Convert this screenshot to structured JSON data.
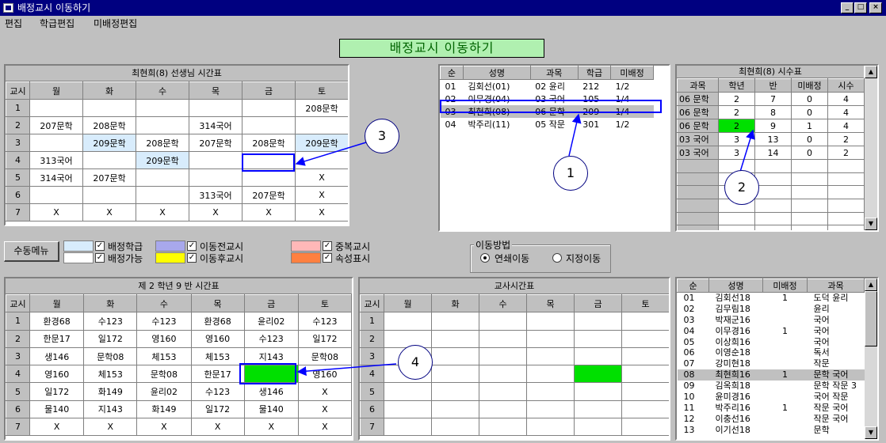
{
  "window": {
    "title": "배정교시 이동하기"
  },
  "menu": [
    "편집",
    "학급편집",
    "미배정편집"
  ],
  "banner": "배정교시 이동하기",
  "teacher_tt": {
    "caption": "최현희(8) 선생님 시간표",
    "corner": "교시",
    "days": [
      "월",
      "화",
      "수",
      "목",
      "금",
      "토"
    ],
    "rows": [
      {
        "p": "1",
        "c": [
          "",
          "",
          "",
          "",
          "",
          "208문학"
        ]
      },
      {
        "p": "2",
        "c": [
          "207문학",
          "208문학",
          "",
          "314국어",
          "",
          ""
        ]
      },
      {
        "p": "3",
        "c": [
          "",
          "209문학",
          "208문학",
          "207문학",
          "208문학",
          "209문학"
        ]
      },
      {
        "p": "4",
        "c": [
          "313국어",
          "",
          "209문학",
          "",
          "",
          ""
        ]
      },
      {
        "p": "5",
        "c": [
          "314국어",
          "207문학",
          "",
          "",
          "",
          "X"
        ]
      },
      {
        "p": "6",
        "c": [
          "",
          "",
          "",
          "313국어",
          "207문학",
          "X"
        ]
      },
      {
        "p": "7",
        "c": [
          "X",
          "X",
          "X",
          "X",
          "X",
          "X"
        ]
      }
    ]
  },
  "teacher_list": {
    "headers": [
      "순",
      "성명",
      "과목",
      "학급",
      "미배정"
    ],
    "rows": [
      [
        "01",
        "김회선(01)",
        "02 윤리",
        "212",
        "1/2"
      ],
      [
        "02",
        "이무경(04)",
        "03 국어",
        "105",
        "1/4"
      ],
      [
        "03",
        "최현희(08)",
        "06 문학",
        "209",
        "1/4"
      ],
      [
        "04",
        "박주리(11)",
        "05 작문",
        "301",
        "1/2"
      ]
    ]
  },
  "hours": {
    "caption": "최현희(8) 시수표",
    "headers": [
      "과목",
      "학년",
      "반",
      "미배정",
      "시수"
    ],
    "rows": [
      [
        "06 문학",
        "2",
        "7",
        "0",
        "4"
      ],
      [
        "06 문학",
        "2",
        "8",
        "0",
        "4"
      ],
      [
        "06 문학",
        "2",
        "9",
        "1",
        "4"
      ],
      [
        "03 국어",
        "3",
        "13",
        "0",
        "2"
      ],
      [
        "03 국어",
        "3",
        "14",
        "0",
        "2"
      ]
    ]
  },
  "controls": {
    "manual_menu": "수동메뉴",
    "legend": [
      {
        "label": "배정학급",
        "color": "#d8ecfc"
      },
      {
        "label": "배정가능",
        "color": "#ffffff"
      },
      {
        "label": "이동전교시",
        "color": "#a8a8ec"
      },
      {
        "label": "이동후교시",
        "color": "#ffff00"
      },
      {
        "label": "중복교시",
        "color": "#ffb8b8"
      },
      {
        "label": "속성표시",
        "color": "#ff8040"
      }
    ],
    "move_method": {
      "label": "이동방법",
      "options": [
        "연쇄이동",
        "지정이동"
      ],
      "selected": "연쇄이동"
    }
  },
  "class_tt": {
    "caption": "제 2 학년 9 반 시간표",
    "corner": "교시",
    "days": [
      "월",
      "화",
      "수",
      "목",
      "금",
      "토"
    ],
    "rows": [
      {
        "p": "1",
        "c": [
          "환경68",
          "수123",
          "수123",
          "환경68",
          "윤리02",
          "수123"
        ]
      },
      {
        "p": "2",
        "c": [
          "한문17",
          "일172",
          "영160",
          "영160",
          "수123",
          "일172"
        ]
      },
      {
        "p": "3",
        "c": [
          "생146",
          "문학08",
          "체153",
          "체153",
          "지143",
          "문학08"
        ]
      },
      {
        "p": "4",
        "c": [
          "영160",
          "체153",
          "문학08",
          "한문17",
          "",
          "영160"
        ]
      },
      {
        "p": "5",
        "c": [
          "일172",
          "화149",
          "윤리02",
          "수123",
          "생146",
          "X"
        ]
      },
      {
        "p": "6",
        "c": [
          "물140",
          "지143",
          "화149",
          "일172",
          "물140",
          "X"
        ]
      },
      {
        "p": "7",
        "c": [
          "X",
          "X",
          "X",
          "X",
          "X",
          "X"
        ]
      }
    ]
  },
  "teacher_tt2": {
    "caption": "교사시간표",
    "corner": "교시",
    "days": [
      "월",
      "화",
      "수",
      "목",
      "금",
      "토"
    ],
    "periods": [
      "1",
      "2",
      "3",
      "4",
      "5",
      "6",
      "7"
    ]
  },
  "staff": {
    "headers": [
      "순",
      "성명",
      "미배정",
      "과목"
    ],
    "rows": [
      [
        "01",
        "김회선18",
        "1",
        "도덕 윤리"
      ],
      [
        "02",
        "김무림18",
        "",
        "윤리"
      ],
      [
        "03",
        "박재군16",
        "",
        "국어"
      ],
      [
        "04",
        "이무경16",
        "1",
        "국어"
      ],
      [
        "05",
        "이상희16",
        "",
        "국어"
      ],
      [
        "06",
        "이영순18",
        "",
        "독서"
      ],
      [
        "07",
        "강미현18",
        "",
        "작문"
      ],
      [
        "08",
        "최현희16",
        "1",
        "문학 국어"
      ],
      [
        "09",
        "김옥희18",
        "",
        "문학 작문 3"
      ],
      [
        "10",
        "윤미경16",
        "",
        "국어 작문"
      ],
      [
        "11",
        "박주리16",
        "1",
        "작문 국어"
      ],
      [
        "12",
        "이충선16",
        "",
        "작문 국어"
      ],
      [
        "13",
        "이기선18",
        "",
        "문학"
      ]
    ]
  },
  "callouts": [
    "1",
    "2",
    "3",
    "4"
  ],
  "colors": {
    "assigned": "#d8ecfc",
    "green": "#00e000",
    "selected": "#c0c0c0",
    "highlight_box": "#0000ff"
  }
}
